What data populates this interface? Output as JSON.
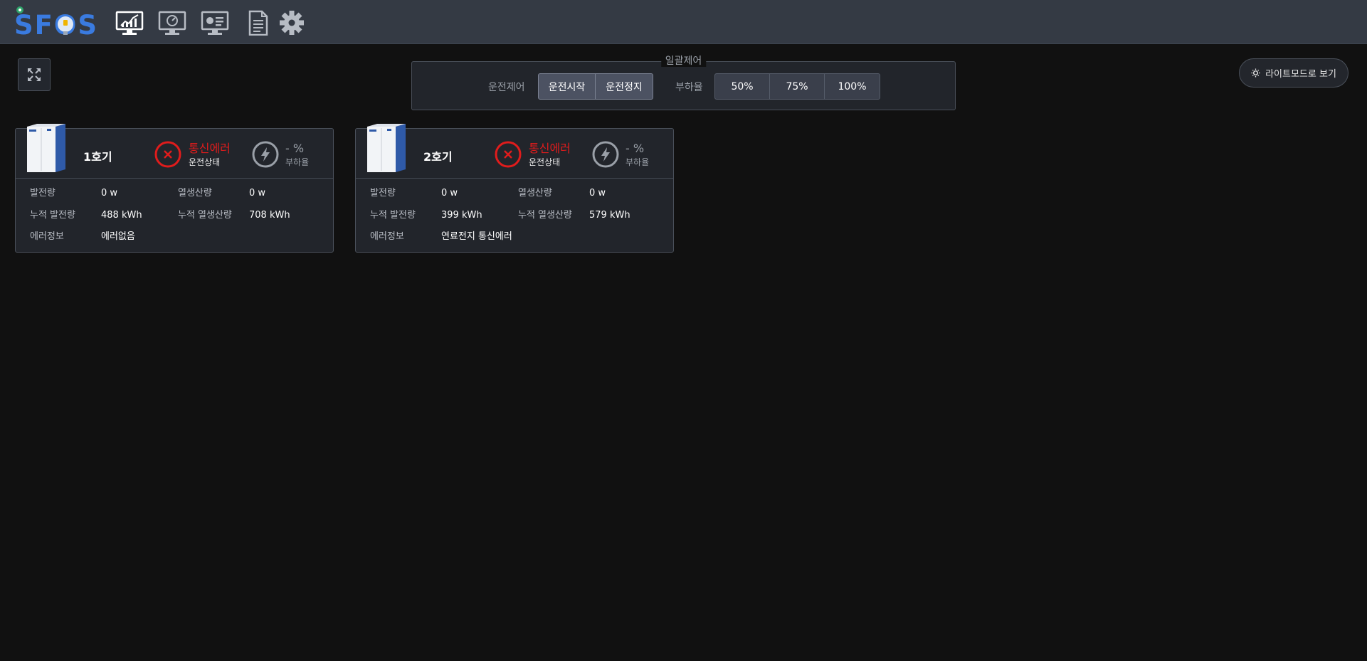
{
  "app": {
    "logo_text": "SFOS"
  },
  "nav": [
    {
      "name": "monitoring-chart-icon"
    },
    {
      "name": "dashboard-monitor-icon"
    },
    {
      "name": "status-monitor-icon"
    },
    {
      "name": "report-document-icon"
    },
    {
      "name": "settings-gear-icon"
    }
  ],
  "batch_control": {
    "title": "일괄제어",
    "operation_label": "운전제어",
    "start_label": "운전시작",
    "stop_label": "운전정지",
    "load_label": "부하율",
    "load_options": [
      "50%",
      "75%",
      "100%"
    ]
  },
  "light_mode": {
    "label": "라이트모드로 보기"
  },
  "units": [
    {
      "name": "1호기",
      "status": "통신에러",
      "status_label": "운전상태",
      "load_value": "- %",
      "load_label": "부하율",
      "power_label": "발전량",
      "power_value": "0 w",
      "heat_label": "열생산량",
      "heat_value": "0 w",
      "cum_power_label": "누적 발전량",
      "cum_power_value": "488 kWh",
      "cum_heat_label": "누적 열생산량",
      "cum_heat_value": "708 kWh",
      "error_label": "에러정보",
      "error_value": "에러없음"
    },
    {
      "name": "2호기",
      "status": "통신에러",
      "status_label": "운전상태",
      "load_value": "- %",
      "load_label": "부하율",
      "power_label": "발전량",
      "power_value": "0 w",
      "heat_label": "열생산량",
      "heat_value": "0 w",
      "cum_power_label": "누적 발전량",
      "cum_power_value": "399 kWh",
      "cum_heat_label": "누적 열생산량",
      "cum_heat_value": "579 kWh",
      "error_label": "에러정보",
      "error_value": "연료전지 통신에러"
    }
  ],
  "colors": {
    "topbar": "#343a44",
    "background": "#111111",
    "card": "#22252b",
    "error_red": "#e01c1c",
    "logo_blue": "#3a7be0"
  }
}
